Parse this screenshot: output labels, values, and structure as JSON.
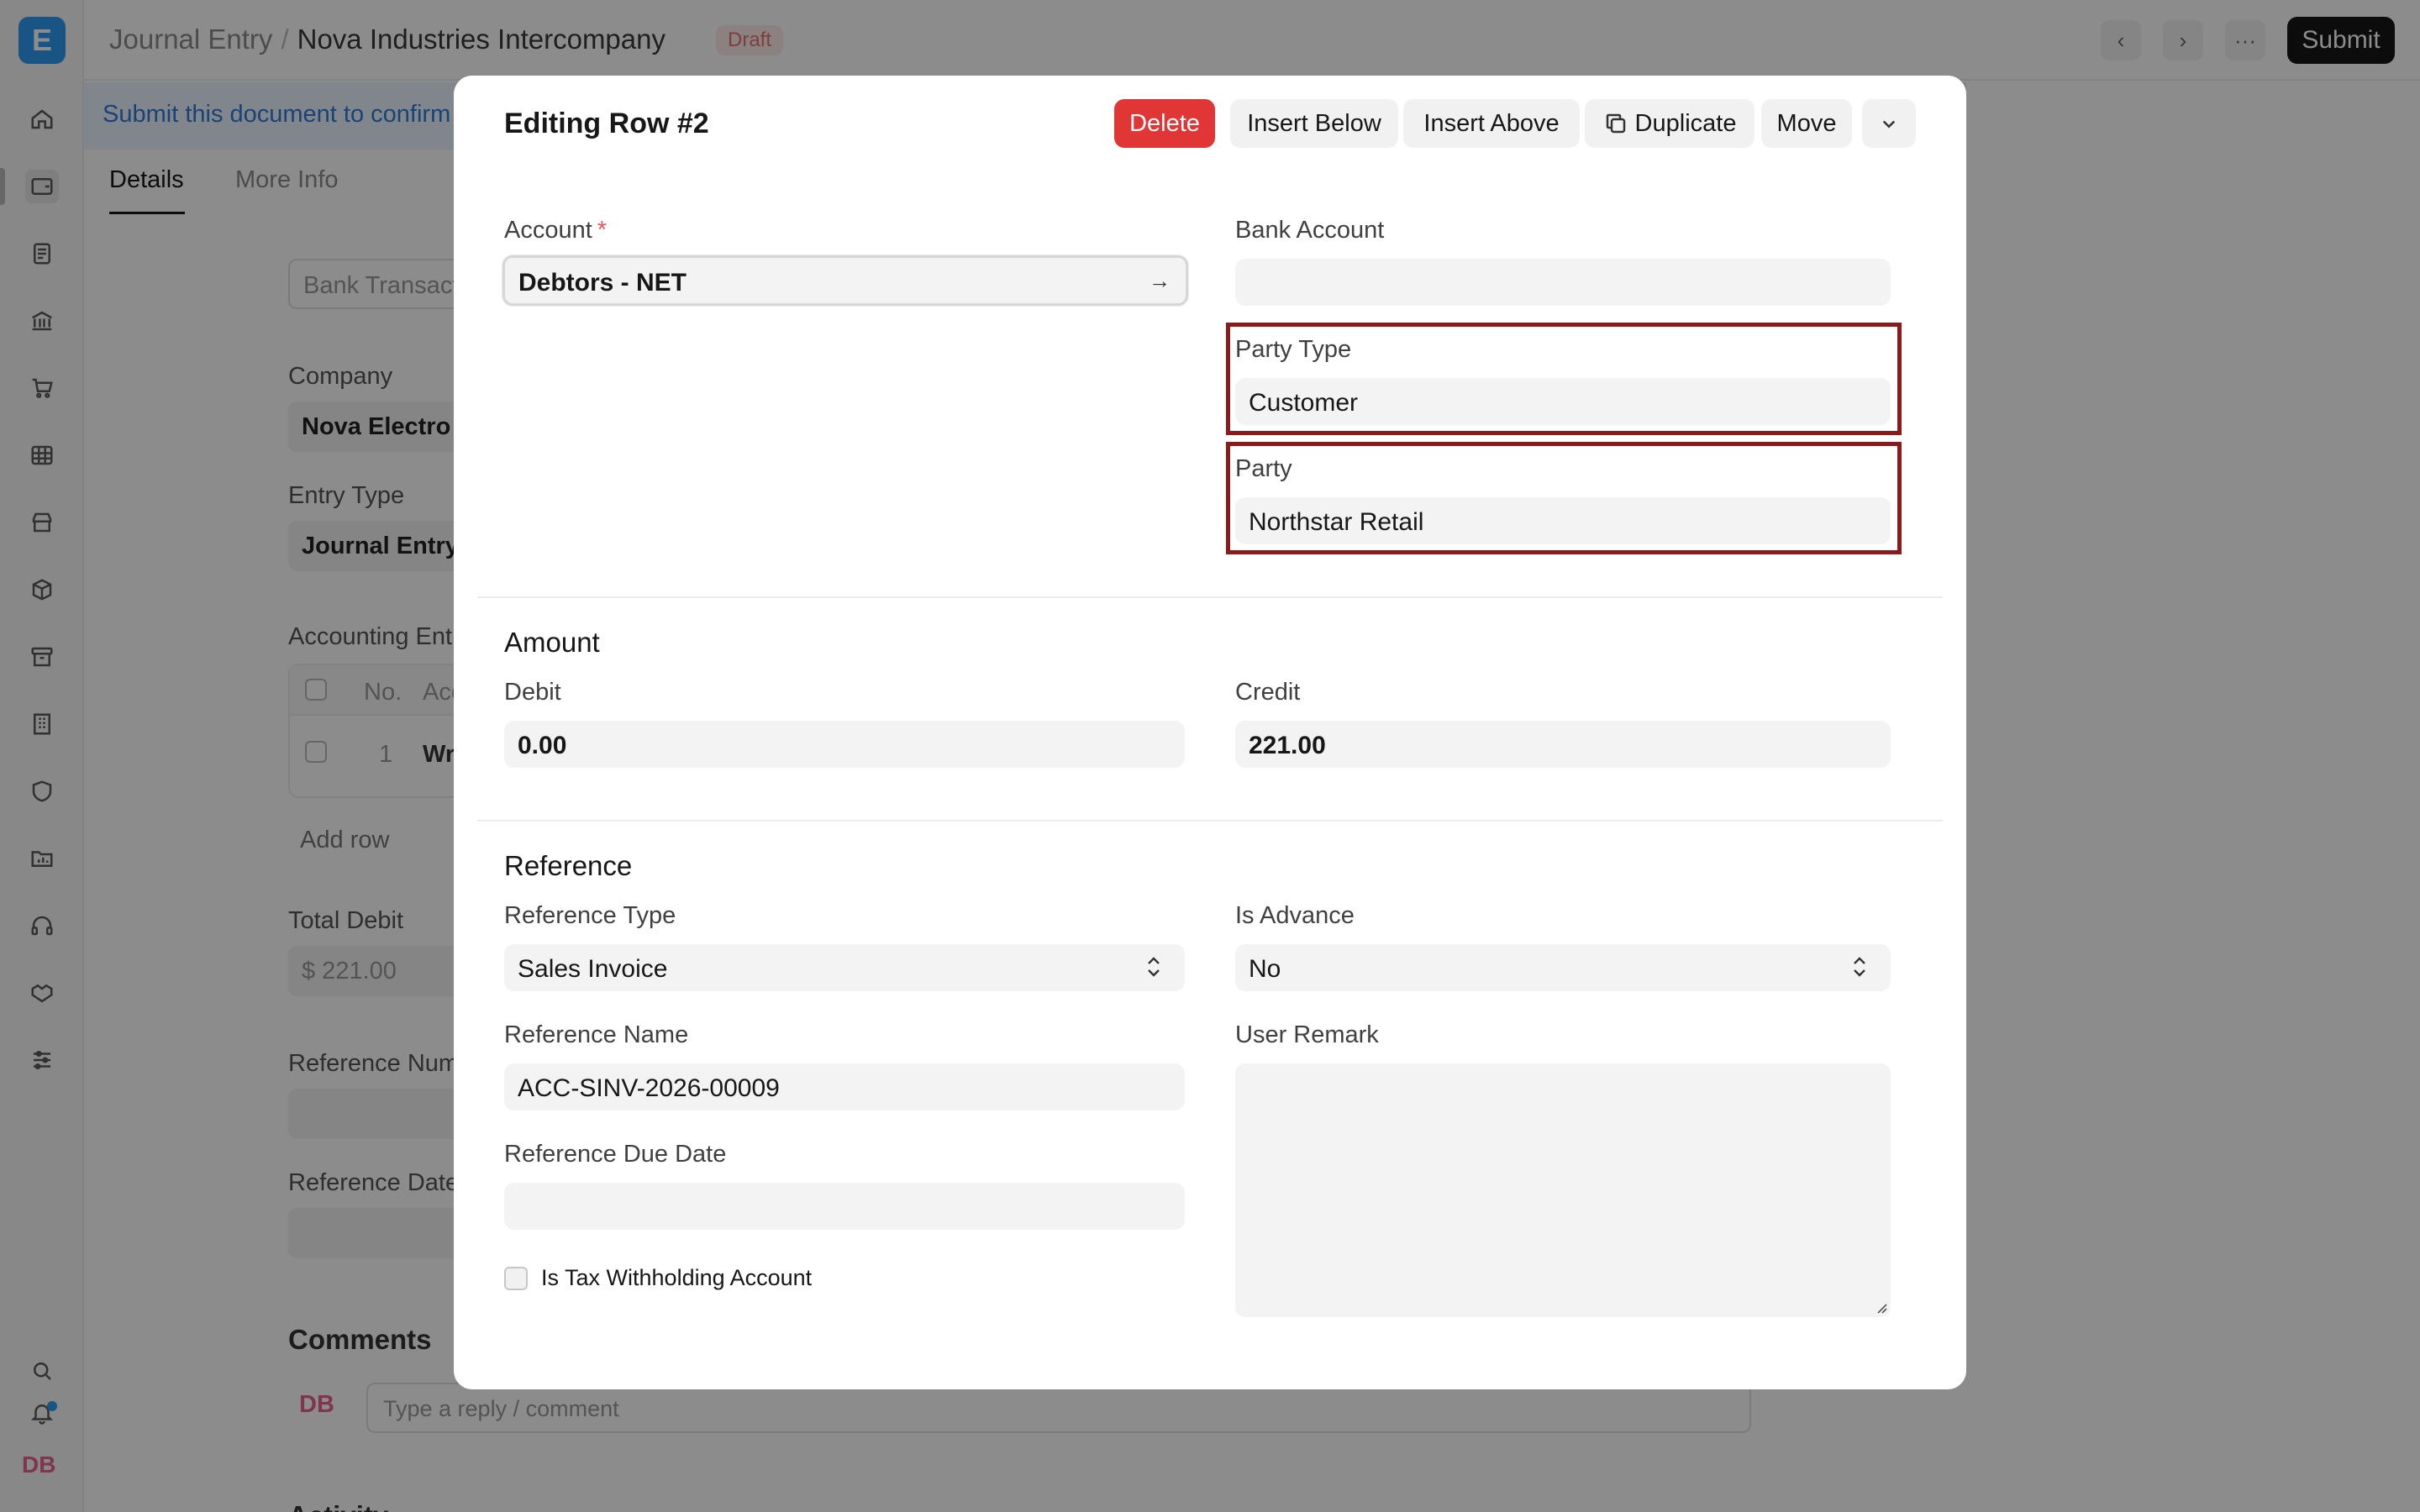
{
  "app": {
    "logo_letter": "E",
    "breadcrumb_root": "Journal Entry",
    "breadcrumb_separator": "/",
    "doc_title": "Nova Industries Intercompany",
    "status_badge": "Draft",
    "submit_label": "Submit",
    "banner_text": "Submit this document to confirm",
    "tabs": [
      "Details",
      "More Info"
    ],
    "user_initials": "DB",
    "bg_fields": {
      "bank_transaction_placeholder": "Bank Transact",
      "company_label": "Company",
      "company_value": "Nova Electro",
      "entry_type_label": "Entry Type",
      "entry_type_value": "Journal Entry",
      "accounting_entries_label": "Accounting Ent",
      "grid_no_header": "No.",
      "grid_account_header": "Acc",
      "grid_row1_no": "1",
      "grid_row1_account": "Wr",
      "add_row": "Add row",
      "total_debit_label": "Total Debit",
      "total_debit_value": "$ 221.00",
      "reference_number_label": "Reference Num",
      "reference_date_label": "Reference Date",
      "comments_title": "Comments",
      "comment_placeholder": "Type a reply / comment",
      "activity_title": "Activity"
    }
  },
  "modal": {
    "title": "Editing Row #2",
    "buttons": {
      "delete": "Delete",
      "insert_below": "Insert Below",
      "insert_above": "Insert Above",
      "duplicate": "Duplicate",
      "move": "Move"
    },
    "account": {
      "label": "Account",
      "required_mark": "*",
      "value": "Debtors - NET"
    },
    "bank_account": {
      "label": "Bank Account",
      "value": ""
    },
    "party_type": {
      "label": "Party Type",
      "value": "Customer"
    },
    "party": {
      "label": "Party",
      "value": "Northstar Retail"
    },
    "amount_section": "Amount",
    "debit": {
      "label": "Debit",
      "value": "0.00"
    },
    "credit": {
      "label": "Credit",
      "value": "221.00"
    },
    "reference_section": "Reference",
    "reference_type": {
      "label": "Reference Type",
      "value": "Sales Invoice"
    },
    "is_advance": {
      "label": "Is Advance",
      "value": "No"
    },
    "reference_name": {
      "label": "Reference Name",
      "value": "ACC-SINV-2026-00009"
    },
    "user_remark": {
      "label": "User Remark",
      "value": ""
    },
    "reference_due_date": {
      "label": "Reference Due Date",
      "value": ""
    },
    "tax_withholding": {
      "label": "Is Tax Withholding Account",
      "checked": false
    },
    "highlight_color": "#8b1a1a",
    "delete_color": "#e03636"
  }
}
